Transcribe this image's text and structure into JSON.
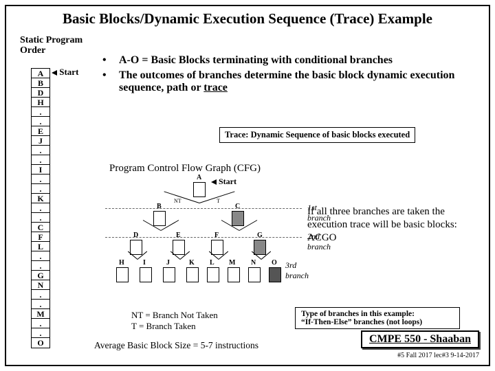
{
  "title": "Basic Blocks/Dynamic Execution Sequence (Trace) Example",
  "static_label_1": "Static Program",
  "static_label_2": "Order",
  "start_label": "Start",
  "program": [
    "A",
    "B",
    "D",
    "H",
    ".",
    ".",
    "E",
    "J",
    ".",
    ".",
    "I",
    ".",
    ".",
    "K",
    ".",
    ".",
    "C",
    "F",
    "L",
    ".",
    ".",
    "G",
    "N",
    ".",
    ".",
    "M",
    ".",
    ".",
    "O"
  ],
  "bullets": [
    "A-O = Basic Blocks terminating with conditional branches",
    "The outcomes of branches determine the basic block dynamic execution sequence, path or trace"
  ],
  "trace_box": "Trace:  Dynamic Sequence of basic blocks executed",
  "cfg_label": "Program Control Flow Graph (CFG)",
  "start2": "Start",
  "branch1": "1st branch",
  "branch2": "2nd branch",
  "branch3": "3rd branch",
  "if_text": "If all three branches are taken the execution trace will be basic blocks:  ACGO",
  "legend_nt": "NT =  Branch Not Taken",
  "legend_t": "T    =  Branch Taken",
  "type_box_1": "Type of branches in this example:",
  "type_box_2": "“If-Then-Else” branches (not loops)",
  "avg": "Average Basic Block Size = 5-7 instructions",
  "course": "CMPE 550 - Shaaban",
  "lec": "#5  Fall 2017   lec#3  9-14-2017",
  "nodes": [
    "A",
    "B",
    "C",
    "D",
    "E",
    "F",
    "G",
    "H",
    "I",
    "J",
    "K",
    "L",
    "M",
    "N",
    "O"
  ],
  "tnt_labels": {
    "nt": "NT",
    "t": "T"
  }
}
